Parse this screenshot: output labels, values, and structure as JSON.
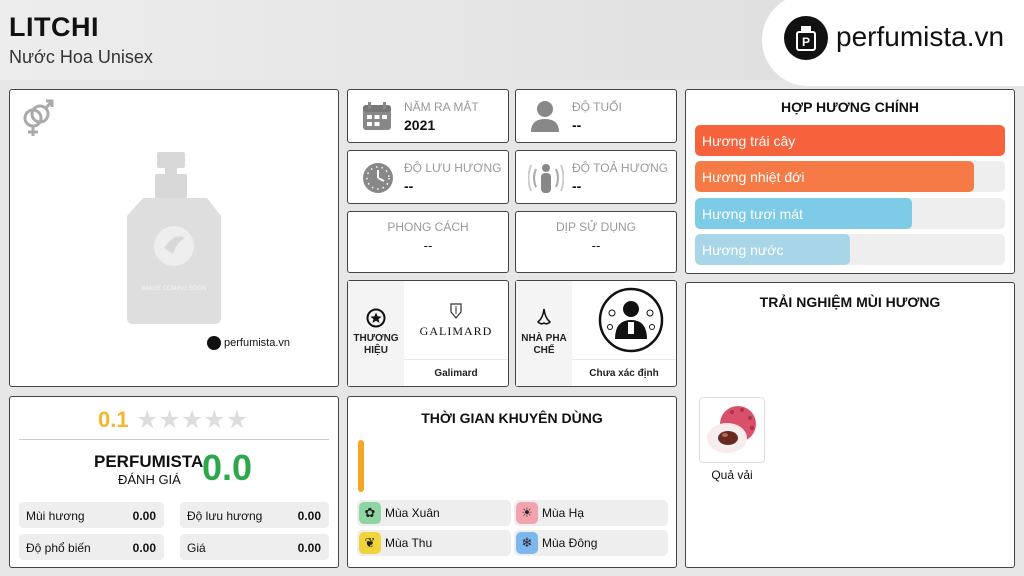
{
  "header": {
    "title": "LITCHI",
    "subtitle": "Nước Hoa Unisex",
    "logo_text": "perfumista.vn"
  },
  "product_image": {
    "placeholder_text": "IMAGE COMING SOON",
    "watermark": "perfumista.vn",
    "gender_icon": "gender-unisex-icon"
  },
  "info": {
    "year": {
      "label": "NĂM RA MẮT",
      "value": "2021",
      "icon": "calendar-icon"
    },
    "age": {
      "label": "ĐỘ TUỔI",
      "value": "--",
      "icon": "person-icon"
    },
    "longevity": {
      "label": "ĐỘ LƯU HƯƠNG",
      "value": "--",
      "icon": "clock-icon"
    },
    "sillage": {
      "label": "ĐỘ TOẢ HƯƠNG",
      "value": "--",
      "icon": "sillage-icon"
    },
    "style": {
      "label": "PHONG CÁCH",
      "value": "--"
    },
    "occasion": {
      "label": "DỊP SỬ DỤNG",
      "value": "--"
    },
    "brand": {
      "label": "THƯƠNG HIỆU",
      "logo_text": "GALIMARD",
      "name": "Galimard",
      "icon": "star-badge-icon"
    },
    "perfumer": {
      "label": "NHÀ PHA CHẾ",
      "name": "Chưa xác định",
      "icon": "nose-icon"
    }
  },
  "accords": {
    "title": "HỢP HƯƠNG CHÍNH",
    "items": [
      {
        "label": "Hương trái cây",
        "value": 1.0,
        "color": "#f5623c"
      },
      {
        "label": "Hương nhiệt đới",
        "value": 0.9,
        "color": "#f57a46"
      },
      {
        "label": "Hương tươi mát",
        "value": 0.7,
        "color": "#7ecbe8"
      },
      {
        "label": "Hương nước",
        "value": 0.5,
        "color": "#a8d5e8"
      }
    ]
  },
  "rating": {
    "user_score": "0.1",
    "stars_total": 5,
    "brand_label": "PERFUMISTA",
    "eval_label": "ĐÁNH GIÁ",
    "score": "0.0",
    "metrics": [
      {
        "label": "Mùi hương",
        "value": "0.00"
      },
      {
        "label": "Độ lưu hương",
        "value": "0.00"
      },
      {
        "label": "Độ phổ biến",
        "value": "0.00"
      },
      {
        "label": "Giá",
        "value": "0.00"
      }
    ]
  },
  "usage_time": {
    "title": "THỜI GIAN KHUYÊN DÙNG",
    "seasons": [
      {
        "label": "Mùa Xuân",
        "color": "#8fd4a3",
        "icon": "flower-icon"
      },
      {
        "label": "Mùa Hạ",
        "color": "#f2a3ad",
        "icon": "sun-icon"
      },
      {
        "label": "Mùa Thu",
        "color": "#f0d43c",
        "icon": "leaf-icon"
      },
      {
        "label": "Mùa Đông",
        "color": "#7eb6ee",
        "icon": "snowflake-icon"
      }
    ],
    "indicator_color": "#f5a623"
  },
  "notes": {
    "title": "TRẢI NGHIỆM MÙI HƯƠNG",
    "items": [
      {
        "label": "Quả vải"
      }
    ]
  }
}
